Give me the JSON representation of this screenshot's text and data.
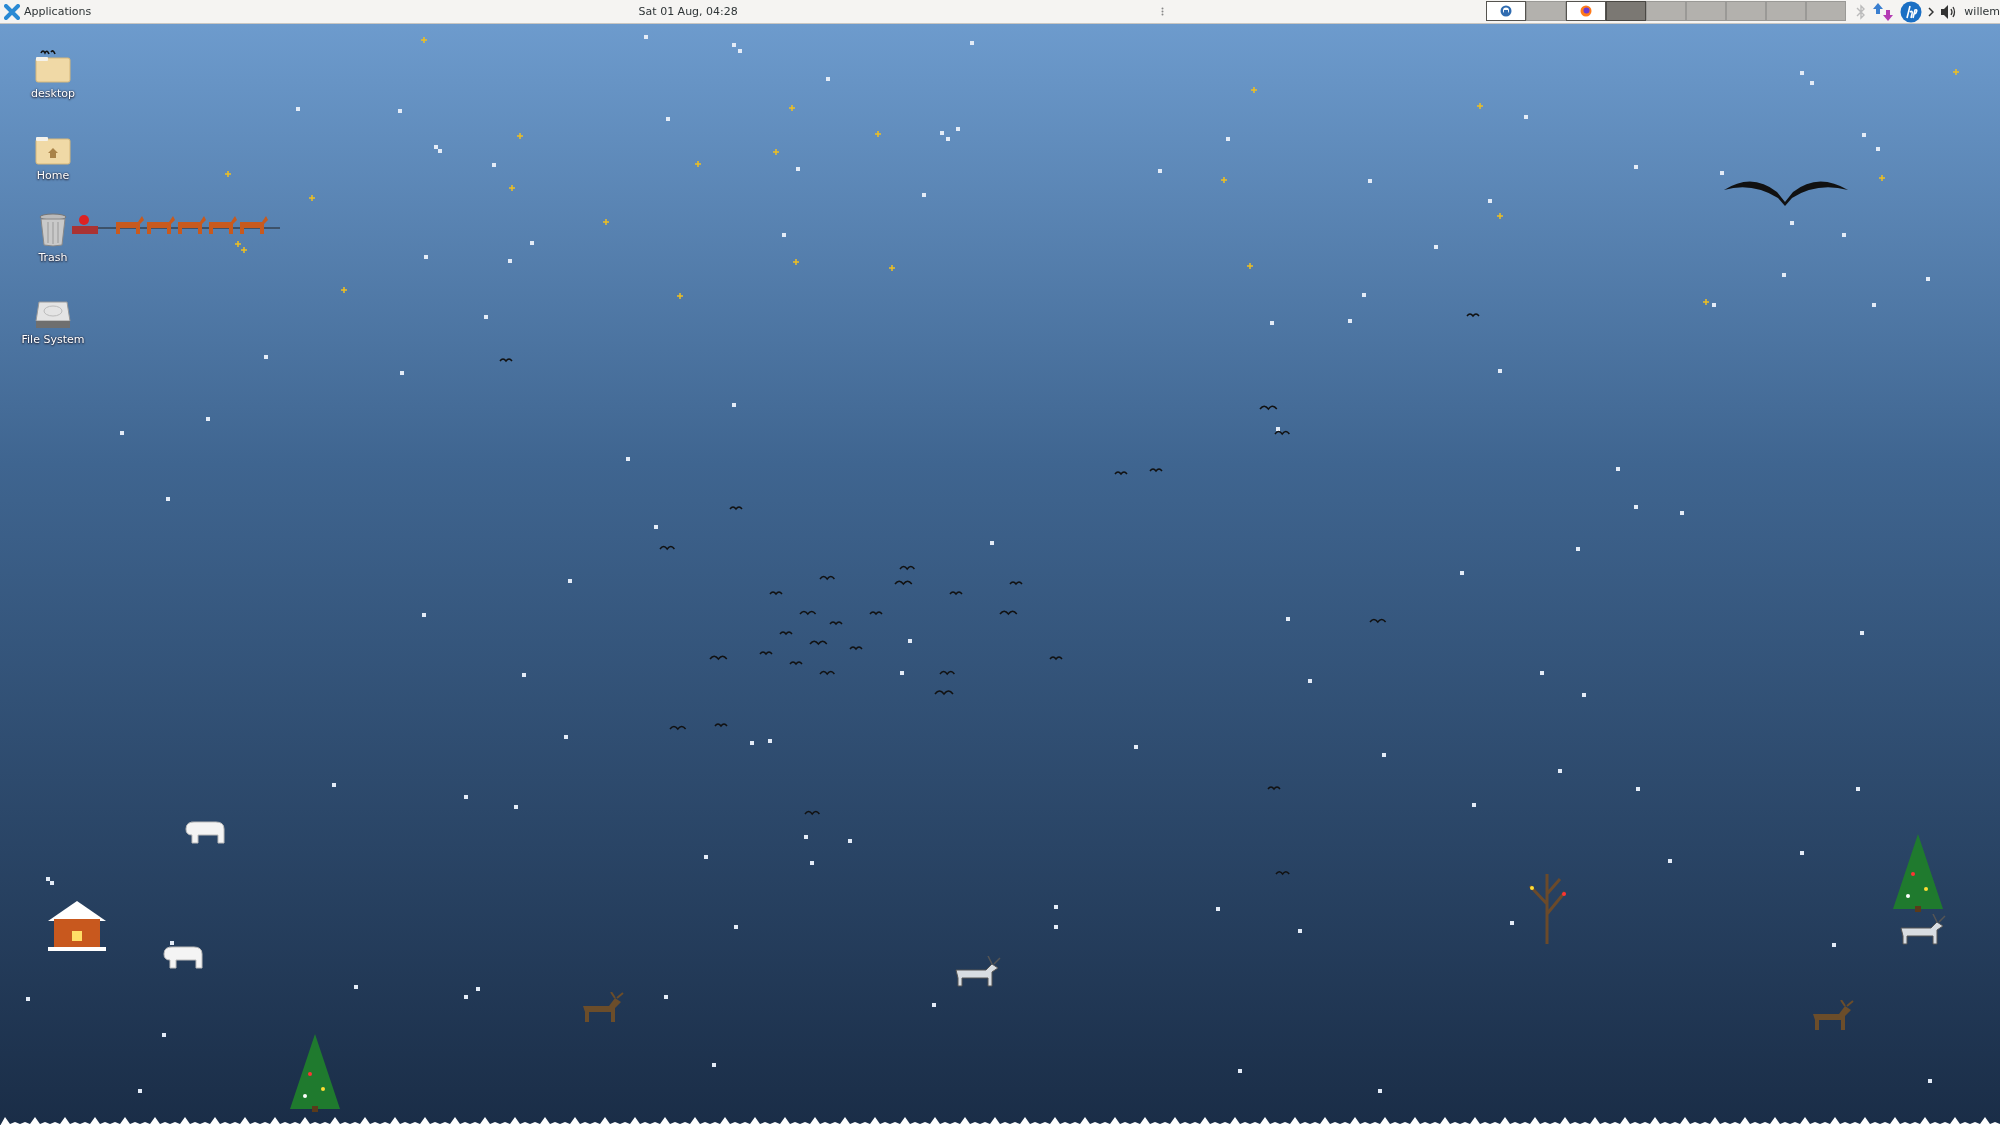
{
  "panel": {
    "menu_label": "Applications",
    "clock": "Sat 01 Aug, 04:28",
    "user": "willem"
  },
  "workspaces": [
    {
      "selected": false,
      "kind": "chat"
    },
    {
      "selected": false,
      "kind": "empty"
    },
    {
      "selected": false,
      "kind": "browser"
    },
    {
      "selected": true,
      "kind": "empty"
    },
    {
      "selected": false,
      "kind": "empty"
    },
    {
      "selected": false,
      "kind": "empty"
    },
    {
      "selected": false,
      "kind": "empty"
    },
    {
      "selected": false,
      "kind": "empty"
    },
    {
      "selected": false,
      "kind": "empty"
    }
  ],
  "desktop_icons": [
    {
      "label": "desktop",
      "kind": "folder"
    },
    {
      "label": "Home",
      "kind": "home"
    },
    {
      "label": "Trash",
      "kind": "trash"
    },
    {
      "label": "File System",
      "kind": "drive"
    }
  ]
}
